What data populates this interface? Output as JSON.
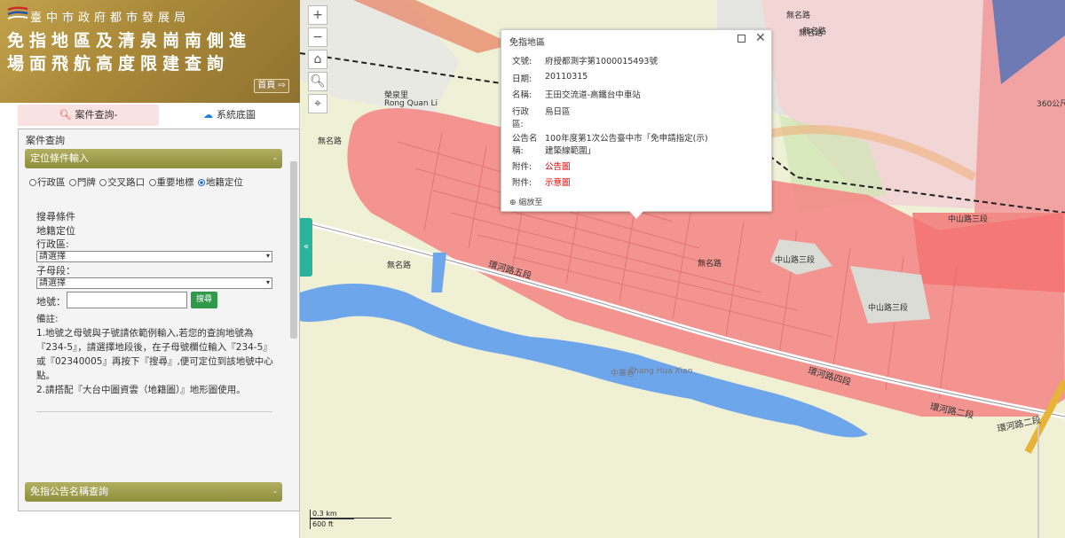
{
  "header": {
    "agency": "臺中市政府都市發展局",
    "title_line1": "免指地區及清泉崗南側進",
    "title_line2": "場面飛航高度限建查詢",
    "home_button": "首頁"
  },
  "tabs": [
    {
      "label": "案件查詢-",
      "icon": "search-icon",
      "active": true
    },
    {
      "label": "系統底圖",
      "icon": "cloud-icon",
      "active": false
    }
  ],
  "panel": {
    "breadcrumb": "案件查詢",
    "section1": {
      "label": "定位條件輸入",
      "toggle": "-"
    },
    "radio_options": [
      "行政區",
      "門牌",
      "交叉路口",
      "重要地標",
      "地籍定位"
    ],
    "radio_selected": "地籍定位",
    "search_condition_label": "搜尋條件",
    "search_condition_value": "地籍定位",
    "district_label": "行政區:",
    "district_select": "請選擇",
    "section_label": "子母段：",
    "section_select": "請選擇",
    "landno_label": "地號：",
    "landno_value": "",
    "search_button": "搜尋",
    "notes": [
      "備註:",
      "1.地號之母號與子號請依範例輸入,若您的查詢地號為『234-5』，請選擇地段後，在子母號欄位輸入『234-5』或『02340005』再按下『搜尋』,便可定位到該地號中心點。",
      "2.請搭配『大台中圖資雲（地籍圖）』地形圖使用。"
    ],
    "section2": {
      "label": "免指公告名稱查詢",
      "toggle": "-"
    }
  },
  "map": {
    "collapse_tab": "«",
    "scale_km": "0.3 km",
    "scale_ft": "600 ft",
    "labels": {
      "road_huanhe5": "環河路五段",
      "road_huanhe4": "環河路四段",
      "road_huanhe2a": "環河路二段",
      "road_huanhe2b": "環河路二段",
      "road_zhongshan3": "中山路三段",
      "road_zhongshan3b": "中山路三段",
      "road_zhongshan3c": "中山路三段",
      "road_wuming1": "無名路",
      "road_wuming2": "無名路",
      "road_wuming3": "無名路",
      "road_wuming4": "無名路",
      "road_wuming5": "無名路",
      "road_wuming6": "無名路",
      "road_360": "360公尺",
      "rongquan": "榮泉里",
      "rongquan_en": "Rong Quan Li",
      "zhonghua": "中華巷",
      "zhonghua_en": "Zhang Hua Xian"
    }
  },
  "popup": {
    "title": "免指地區",
    "rows": [
      {
        "key": "文號:",
        "value": "府授都測字第1000015493號",
        "red": false
      },
      {
        "key": "日期:",
        "value": "20110315",
        "red": false
      },
      {
        "key": "名稱:",
        "value": "王田交流道-高鐵台中車站",
        "red": false
      },
      {
        "key": "行政區:",
        "value": "烏日區",
        "red": false
      },
      {
        "key": "公告名稱:",
        "value": "100年度第1次公告臺中市「免申請指定(示)建築線範圍」",
        "red": false
      },
      {
        "key": "附件:",
        "value": "公告圖",
        "red": true
      },
      {
        "key": "附件:",
        "value": "示意圖",
        "red": true
      }
    ],
    "zoom_link": "縮放至"
  },
  "colors": {
    "header_gold": "#a88838",
    "section_olive": "#9d9c4c",
    "zone_red": "#f48484",
    "water_blue": "#6ea6ec",
    "search_green": "#2e9a4a",
    "collapse_teal": "#2bb39c"
  }
}
